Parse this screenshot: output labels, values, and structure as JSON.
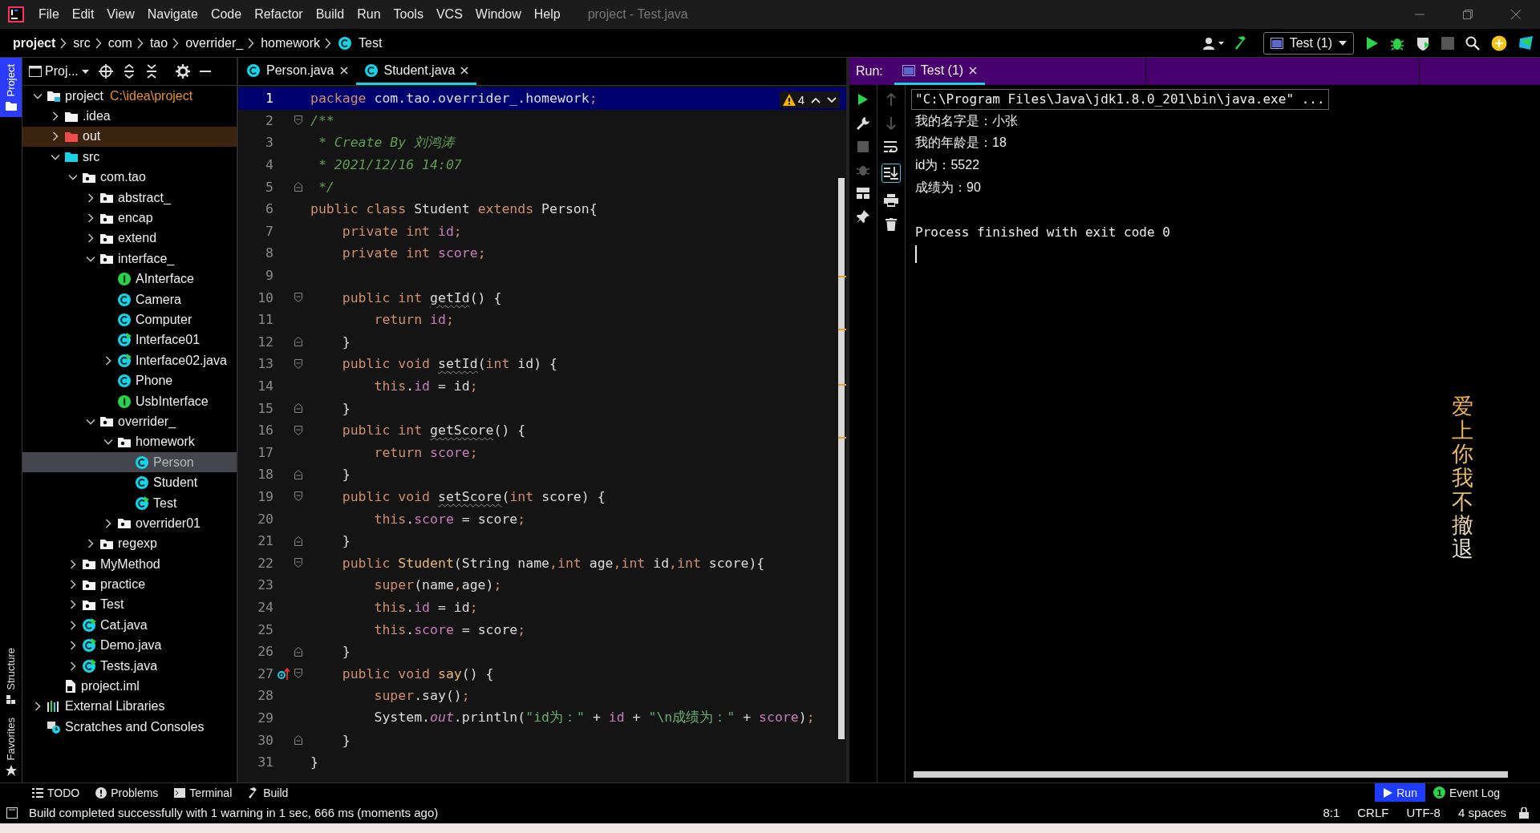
{
  "window": {
    "title": "project - Test.java",
    "menu": [
      "File",
      "Edit",
      "View",
      "Navigate",
      "Code",
      "Refactor",
      "Build",
      "Run",
      "Tools",
      "VCS",
      "Window",
      "Help"
    ]
  },
  "breadcrumb": [
    {
      "label": "project",
      "kind": "module"
    },
    {
      "label": "src",
      "kind": "folder"
    },
    {
      "label": "com",
      "kind": "folder"
    },
    {
      "label": "tao",
      "kind": "folder"
    },
    {
      "label": "overrider_",
      "kind": "folder"
    },
    {
      "label": "homework",
      "kind": "folder"
    },
    {
      "label": "Test",
      "kind": "class"
    }
  ],
  "run_config": {
    "label": "Test (1)"
  },
  "side_tabs": [
    {
      "label": "Project",
      "selected": true,
      "kind": "folder"
    },
    {
      "label": "Structure",
      "selected": false,
      "kind": "structure"
    },
    {
      "label": "Favorites",
      "selected": false,
      "kind": "star"
    }
  ],
  "project": {
    "header": "Proj...",
    "tree": [
      {
        "label": "project",
        "kind": "module",
        "detail": "C:\\idea\\project",
        "expandable": true,
        "expanded": true,
        "selected": false,
        "children": [
          {
            "label": ".idea",
            "kind": "folder",
            "expandable": true,
            "expanded": false,
            "selected": false
          },
          {
            "label": "out",
            "kind": "excluded",
            "expandable": true,
            "expanded": false,
            "selected": false
          },
          {
            "label": "src",
            "kind": "source",
            "expandable": true,
            "expanded": true,
            "selected": false,
            "children": [
              {
                "label": "com.tao",
                "kind": "package",
                "expandable": true,
                "expanded": true,
                "selected": false,
                "children": [
                  {
                    "label": "abstract_",
                    "kind": "package",
                    "expandable": true,
                    "expanded": false,
                    "selected": false
                  },
                  {
                    "label": "encap",
                    "kind": "package",
                    "expandable": true,
                    "expanded": false,
                    "selected": false
                  },
                  {
                    "label": "extend",
                    "kind": "package",
                    "expandable": true,
                    "expanded": false,
                    "selected": false
                  },
                  {
                    "label": "interface_",
                    "kind": "package",
                    "expandable": true,
                    "expanded": true,
                    "selected": false,
                    "children": [
                      {
                        "label": "AInterface",
                        "kind": "interface",
                        "expandable": false,
                        "expanded": false,
                        "selected": false
                      },
                      {
                        "label": "Camera",
                        "kind": "class",
                        "expandable": false,
                        "expanded": false,
                        "selected": false
                      },
                      {
                        "label": "Computer",
                        "kind": "class",
                        "expandable": false,
                        "expanded": false,
                        "selected": false
                      },
                      {
                        "label": "Interface01",
                        "kind": "runnable",
                        "expandable": false,
                        "expanded": false,
                        "selected": false
                      },
                      {
                        "label": "Interface02.java",
                        "kind": "runnable",
                        "expandable": true,
                        "expanded": false,
                        "selected": false
                      },
                      {
                        "label": "Phone",
                        "kind": "class",
                        "expandable": false,
                        "expanded": false,
                        "selected": false
                      },
                      {
                        "label": "UsbInterface",
                        "kind": "interface",
                        "expandable": false,
                        "expanded": false,
                        "selected": false
                      }
                    ]
                  },
                  {
                    "label": "overrider_",
                    "kind": "package",
                    "expandable": true,
                    "expanded": true,
                    "selected": false,
                    "children": [
                      {
                        "label": "homework",
                        "kind": "package",
                        "expandable": true,
                        "expanded": true,
                        "selected": false,
                        "children": [
                          {
                            "label": "Person",
                            "kind": "class",
                            "expandable": false,
                            "expanded": false,
                            "selected": true
                          },
                          {
                            "label": "Student",
                            "kind": "class",
                            "expandable": false,
                            "expanded": false,
                            "selected": false
                          },
                          {
                            "label": "Test",
                            "kind": "runnable",
                            "expandable": false,
                            "expanded": false,
                            "selected": false
                          }
                        ]
                      },
                      {
                        "label": "overrider01",
                        "kind": "package",
                        "expandable": true,
                        "expanded": false,
                        "selected": false
                      }
                    ]
                  },
                  {
                    "label": "regexp",
                    "kind": "package",
                    "expandable": true,
                    "expanded": false,
                    "selected": false
                  }
                ]
              },
              {
                "label": "MyMethod",
                "kind": "package",
                "expandable": true,
                "expanded": false,
                "selected": false
              },
              {
                "label": "practice",
                "kind": "package",
                "expandable": true,
                "expanded": false,
                "selected": false
              },
              {
                "label": "Test",
                "kind": "package",
                "expandable": true,
                "expanded": false,
                "selected": false
              },
              {
                "label": "Cat.java",
                "kind": "runnable",
                "expandable": true,
                "expanded": false,
                "selected": false
              },
              {
                "label": "Demo.java",
                "kind": "runnable",
                "expandable": true,
                "expanded": false,
                "selected": false
              },
              {
                "label": "Tests.java",
                "kind": "runnable",
                "expandable": true,
                "expanded": false,
                "selected": false
              }
            ]
          },
          {
            "label": "project.iml",
            "kind": "iml",
            "expandable": false,
            "expanded": false,
            "selected": false
          }
        ]
      },
      {
        "label": "External Libraries",
        "kind": "libraries",
        "expandable": true,
        "expanded": false,
        "selected": false
      },
      {
        "label": "Scratches and Consoles",
        "kind": "scratches",
        "expandable": false,
        "expanded": false,
        "selected": false
      }
    ]
  },
  "editor": {
    "tabs": [
      {
        "label": "Person.java",
        "selected": false
      },
      {
        "label": "Student.java",
        "selected": true
      }
    ],
    "warnings": "4",
    "lines": [
      {
        "number": "1",
        "current": true,
        "fold_open": false,
        "fold_close": false,
        "overrides": false,
        "tokens": [
          {
            "kind": "keyword",
            "text": "package"
          },
          {
            "kind": "plain",
            "text": " com.tao.overrider_.homework"
          },
          {
            "kind": "keyword",
            "text": ";"
          }
        ]
      },
      {
        "number": "2",
        "current": false,
        "fold_open": true,
        "fold_close": false,
        "overrides": false,
        "tokens": [
          {
            "kind": "comment",
            "text": "/**"
          }
        ]
      },
      {
        "number": "3",
        "current": false,
        "fold_open": false,
        "fold_close": false,
        "overrides": false,
        "tokens": [
          {
            "kind": "comment",
            "text": " * Create By 刘鸿涛"
          }
        ]
      },
      {
        "number": "4",
        "current": false,
        "fold_open": false,
        "fold_close": false,
        "overrides": false,
        "tokens": [
          {
            "kind": "comment",
            "text": " * 2021/12/16 14:07"
          }
        ]
      },
      {
        "number": "5",
        "current": false,
        "fold_open": false,
        "fold_close": true,
        "overrides": false,
        "tokens": [
          {
            "kind": "comment",
            "text": " */"
          }
        ]
      },
      {
        "number": "6",
        "current": false,
        "fold_open": false,
        "fold_close": false,
        "overrides": false,
        "tokens": [
          {
            "kind": "keyword",
            "text": "public class "
          },
          {
            "kind": "plain",
            "text": "Student "
          },
          {
            "kind": "keyword",
            "text": "extends "
          },
          {
            "kind": "plain",
            "text": "Person{"
          }
        ]
      },
      {
        "number": "7",
        "current": false,
        "fold_open": false,
        "fold_close": false,
        "overrides": false,
        "tokens": [
          {
            "kind": "keyword",
            "text": "    private int "
          },
          {
            "kind": "field",
            "text": "id"
          },
          {
            "kind": "keyword",
            "text": ";"
          }
        ]
      },
      {
        "number": "8",
        "current": false,
        "fold_open": false,
        "fold_close": false,
        "overrides": false,
        "tokens": [
          {
            "kind": "keyword",
            "text": "    private int "
          },
          {
            "kind": "field",
            "text": "score"
          },
          {
            "kind": "keyword",
            "text": ";"
          }
        ]
      },
      {
        "number": "9",
        "current": false,
        "fold_open": false,
        "fold_close": false,
        "overrides": false
      },
      {
        "number": "10",
        "current": false,
        "fold_open": true,
        "fold_close": false,
        "overrides": false,
        "tokens": [
          {
            "kind": "keyword",
            "text": "    public int "
          },
          {
            "kind": "unused",
            "text": "getId"
          },
          {
            "kind": "plain",
            "text": "() {"
          }
        ]
      },
      {
        "number": "11",
        "current": false,
        "fold_open": false,
        "fold_close": false,
        "overrides": false,
        "tokens": [
          {
            "kind": "keyword",
            "text": "        return "
          },
          {
            "kind": "field",
            "text": "id"
          },
          {
            "kind": "keyword",
            "text": ";"
          }
        ]
      },
      {
        "number": "12",
        "current": false,
        "fold_open": false,
        "fold_close": true,
        "overrides": false,
        "tokens": [
          {
            "kind": "plain",
            "text": "    }"
          }
        ]
      },
      {
        "number": "13",
        "current": false,
        "fold_open": true,
        "fold_close": false,
        "overrides": false,
        "tokens": [
          {
            "kind": "keyword",
            "text": "    public void "
          },
          {
            "kind": "unused",
            "text": "setId"
          },
          {
            "kind": "plain",
            "text": "("
          },
          {
            "kind": "keyword",
            "text": "int "
          },
          {
            "kind": "plain",
            "text": "id) {"
          }
        ]
      },
      {
        "number": "14",
        "current": false,
        "fold_open": false,
        "fold_close": false,
        "overrides": false,
        "tokens": [
          {
            "kind": "keyword",
            "text": "        this"
          },
          {
            "kind": "plain",
            "text": "."
          },
          {
            "kind": "field",
            "text": "id"
          },
          {
            "kind": "plain",
            "text": " = id"
          },
          {
            "kind": "keyword",
            "text": ";"
          }
        ]
      },
      {
        "number": "15",
        "current": false,
        "fold_open": false,
        "fold_close": true,
        "overrides": false,
        "tokens": [
          {
            "kind": "plain",
            "text": "    }"
          }
        ]
      },
      {
        "number": "16",
        "current": false,
        "fold_open": true,
        "fold_close": false,
        "overrides": false,
        "tokens": [
          {
            "kind": "keyword",
            "text": "    public int "
          },
          {
            "kind": "unused",
            "text": "getScore"
          },
          {
            "kind": "plain",
            "text": "() {"
          }
        ]
      },
      {
        "number": "17",
        "current": false,
        "fold_open": false,
        "fold_close": false,
        "overrides": false,
        "tokens": [
          {
            "kind": "keyword",
            "text": "        return "
          },
          {
            "kind": "field",
            "text": "score"
          },
          {
            "kind": "keyword",
            "text": ";"
          }
        ]
      },
      {
        "number": "18",
        "current": false,
        "fold_open": false,
        "fold_close": true,
        "overrides": false,
        "tokens": [
          {
            "kind": "plain",
            "text": "    }"
          }
        ]
      },
      {
        "number": "19",
        "current": false,
        "fold_open": true,
        "fold_close": false,
        "overrides": false,
        "tokens": [
          {
            "kind": "keyword",
            "text": "    public void "
          },
          {
            "kind": "unused",
            "text": "setScore"
          },
          {
            "kind": "plain",
            "text": "("
          },
          {
            "kind": "keyword",
            "text": "int "
          },
          {
            "kind": "plain",
            "text": "score) {"
          }
        ]
      },
      {
        "number": "20",
        "current": false,
        "fold_open": false,
        "fold_close": false,
        "overrides": false,
        "tokens": [
          {
            "kind": "keyword",
            "text": "        this"
          },
          {
            "kind": "plain",
            "text": "."
          },
          {
            "kind": "field",
            "text": "score"
          },
          {
            "kind": "plain",
            "text": " = score"
          },
          {
            "kind": "keyword",
            "text": ";"
          }
        ]
      },
      {
        "number": "21",
        "current": false,
        "fold_open": false,
        "fold_close": true,
        "overrides": false,
        "tokens": [
          {
            "kind": "plain",
            "text": "    }"
          }
        ]
      },
      {
        "number": "22",
        "current": false,
        "fold_open": true,
        "fold_close": false,
        "overrides": false,
        "tokens": [
          {
            "kind": "keyword",
            "text": "    public "
          },
          {
            "kind": "declaration",
            "text": "Student"
          },
          {
            "kind": "plain",
            "text": "(String name"
          },
          {
            "kind": "keyword",
            "text": ",int "
          },
          {
            "kind": "plain",
            "text": "age"
          },
          {
            "kind": "keyword",
            "text": ",int "
          },
          {
            "kind": "plain",
            "text": "id"
          },
          {
            "kind": "keyword",
            "text": ",int "
          },
          {
            "kind": "plain",
            "text": "score){"
          }
        ]
      },
      {
        "number": "23",
        "current": false,
        "fold_open": false,
        "fold_close": false,
        "overrides": false,
        "tokens": [
          {
            "kind": "keyword",
            "text": "        super"
          },
          {
            "kind": "plain",
            "text": "(name"
          },
          {
            "kind": "keyword",
            "text": ","
          },
          {
            "kind": "plain",
            "text": "age)"
          },
          {
            "kind": "keyword",
            "text": ";"
          }
        ]
      },
      {
        "number": "24",
        "current": false,
        "fold_open": false,
        "fold_close": false,
        "overrides": false,
        "tokens": [
          {
            "kind": "keyword",
            "text": "        this"
          },
          {
            "kind": "plain",
            "text": "."
          },
          {
            "kind": "field",
            "text": "id"
          },
          {
            "kind": "plain",
            "text": " = id"
          },
          {
            "kind": "keyword",
            "text": ";"
          }
        ]
      },
      {
        "number": "25",
        "current": false,
        "fold_open": false,
        "fold_close": false,
        "overrides": false,
        "tokens": [
          {
            "kind": "keyword",
            "text": "        this"
          },
          {
            "kind": "plain",
            "text": "."
          },
          {
            "kind": "field",
            "text": "score"
          },
          {
            "kind": "plain",
            "text": " = score"
          },
          {
            "kind": "keyword",
            "text": ";"
          }
        ]
      },
      {
        "number": "26",
        "current": false,
        "fold_open": false,
        "fold_close": true,
        "overrides": false,
        "tokens": [
          {
            "kind": "plain",
            "text": "    }"
          }
        ]
      },
      {
        "number": "27",
        "current": false,
        "fold_open": true,
        "fold_close": false,
        "overrides": true,
        "tokens": [
          {
            "kind": "keyword",
            "text": "    public void "
          },
          {
            "kind": "declaration",
            "text": "say"
          },
          {
            "kind": "plain",
            "text": "() {"
          }
        ]
      },
      {
        "number": "28",
        "current": false,
        "fold_open": false,
        "fold_close": false,
        "overrides": false,
        "tokens": [
          {
            "kind": "keyword",
            "text": "        super"
          },
          {
            "kind": "plain",
            "text": ".say()"
          },
          {
            "kind": "keyword",
            "text": ";"
          }
        ]
      },
      {
        "number": "29",
        "current": false,
        "fold_open": false,
        "fold_close": false,
        "overrides": false,
        "tokens": [
          {
            "kind": "plain",
            "text": "        System."
          },
          {
            "kind": "static",
            "text": "out"
          },
          {
            "kind": "plain",
            "text": ".println("
          },
          {
            "kind": "string",
            "text": "\"id为：\""
          },
          {
            "kind": "plain",
            "text": " + "
          },
          {
            "kind": "field",
            "text": "id"
          },
          {
            "kind": "plain",
            "text": " + "
          },
          {
            "kind": "string",
            "text": "\"\\n成绩为：\""
          },
          {
            "kind": "plain",
            "text": " + "
          },
          {
            "kind": "field",
            "text": "score"
          },
          {
            "kind": "plain",
            "text": ")"
          },
          {
            "kind": "keyword",
            "text": ";"
          }
        ]
      },
      {
        "number": "30",
        "current": false,
        "fold_open": false,
        "fold_close": true,
        "overrides": false,
        "tokens": [
          {
            "kind": "plain",
            "text": "    }"
          }
        ]
      },
      {
        "number": "31",
        "current": false,
        "fold_open": false,
        "fold_close": false,
        "overrides": false,
        "tokens": [
          {
            "kind": "plain",
            "text": "}"
          }
        ]
      }
    ]
  },
  "run": {
    "label": "Run:",
    "tab": {
      "label": "Test (1)",
      "selected": true
    },
    "tools_left": [
      {
        "kind": "rerun",
        "disabled": false
      },
      {
        "kind": "wrench",
        "disabled": false
      },
      {
        "kind": "stop",
        "disabled": true
      },
      {
        "kind": "debug",
        "disabled": true
      },
      {
        "kind": "layout",
        "disabled": false
      },
      {
        "kind": "pin",
        "disabled": false
      }
    ],
    "tools_right": [
      {
        "kind": "up",
        "disabled": true,
        "on": false
      },
      {
        "kind": "down",
        "disabled": true,
        "on": false
      },
      {
        "kind": "wrap",
        "disabled": false,
        "on": false
      },
      {
        "kind": "autoscroll",
        "disabled": false,
        "on": true
      },
      {
        "kind": "print",
        "disabled": false,
        "on": false
      },
      {
        "kind": "trash",
        "disabled": false,
        "on": false
      }
    ],
    "console": [
      {
        "kind": "command",
        "text": "\"C:\\Program Files\\Java\\jdk1.8.0_201\\bin\\java.exe\" ..."
      },
      {
        "kind": "output",
        "text": "我的名字是：小张"
      },
      {
        "kind": "output",
        "text": "我的年龄是：18"
      },
      {
        "kind": "output",
        "text": "id为：5522"
      },
      {
        "kind": "output",
        "text": "成绩为：90"
      },
      {
        "kind": "status",
        "text": "Process finished with exit code 0"
      }
    ],
    "caret": true
  },
  "lyrics": "爱上你我不撤退",
  "tool_tabs_left": [
    {
      "label": "TODO",
      "kind": "todo",
      "selected": false
    },
    {
      "label": "Problems",
      "kind": "problems",
      "selected": false
    },
    {
      "label": "Terminal",
      "kind": "terminal",
      "selected": false
    },
    {
      "label": "Build",
      "kind": "build",
      "selected": false
    }
  ],
  "tool_tabs_right": [
    {
      "label": "Run",
      "kind": "run",
      "selected": true
    },
    {
      "label": "Event Log",
      "kind": "log",
      "badge": "1",
      "selected": false
    }
  ],
  "status_bar": {
    "message": "Build completed successfully with 1 warning in 1 sec, 666 ms (moments ago)",
    "items": [
      "8:1",
      "CRLF",
      "UTF-8",
      "4 spaces"
    ]
  }
}
